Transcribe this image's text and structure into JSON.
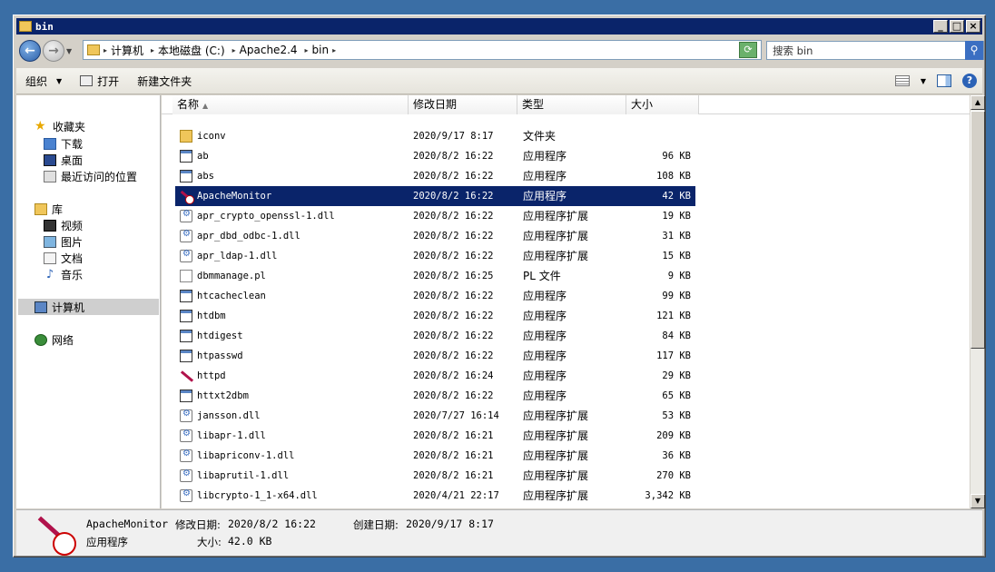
{
  "window": {
    "title": "bin"
  },
  "address": {
    "crumbs": [
      "计算机",
      "本地磁盘 (C:)",
      "Apache2.4",
      "bin"
    ],
    "search_placeholder": "搜索 bin"
  },
  "toolbar": {
    "organize": "组织",
    "open": "打开",
    "new_folder": "新建文件夹"
  },
  "nav": {
    "favorites": "收藏夹",
    "favorites_items": [
      "下载",
      "桌面",
      "最近访问的位置"
    ],
    "libraries": "库",
    "libraries_items": [
      "视频",
      "图片",
      "文档",
      "音乐"
    ],
    "computer": "计算机",
    "network": "网络"
  },
  "columns": {
    "name": "名称",
    "date": "修改日期",
    "type": "类型",
    "size": "大小"
  },
  "files": [
    {
      "name": "iconv",
      "date": "2020/9/17 8:17",
      "type": "文件夹",
      "size": "",
      "icon": "folder-icon"
    },
    {
      "name": "ab",
      "date": "2020/8/2 16:22",
      "type": "应用程序",
      "size": "96 KB",
      "icon": "exe-icon"
    },
    {
      "name": "abs",
      "date": "2020/8/2 16:22",
      "type": "应用程序",
      "size": "108 KB",
      "icon": "exe-icon"
    },
    {
      "name": "ApacheMonitor",
      "date": "2020/8/2 16:22",
      "type": "应用程序",
      "size": "42 KB",
      "icon": "apache-monitor-icon",
      "selected": true
    },
    {
      "name": "apr_crypto_openssl-1.dll",
      "date": "2020/8/2 16:22",
      "type": "应用程序扩展",
      "size": "19 KB",
      "icon": "dll-icon"
    },
    {
      "name": "apr_dbd_odbc-1.dll",
      "date": "2020/8/2 16:22",
      "type": "应用程序扩展",
      "size": "31 KB",
      "icon": "dll-icon"
    },
    {
      "name": "apr_ldap-1.dll",
      "date": "2020/8/2 16:22",
      "type": "应用程序扩展",
      "size": "15 KB",
      "icon": "dll-icon"
    },
    {
      "name": "dbmmanage.pl",
      "date": "2020/8/2 16:25",
      "type": "PL 文件",
      "size": "9 KB",
      "icon": "document-icon"
    },
    {
      "name": "htcacheclean",
      "date": "2020/8/2 16:22",
      "type": "应用程序",
      "size": "99 KB",
      "icon": "exe-icon"
    },
    {
      "name": "htdbm",
      "date": "2020/8/2 16:22",
      "type": "应用程序",
      "size": "121 KB",
      "icon": "exe-icon"
    },
    {
      "name": "htdigest",
      "date": "2020/8/2 16:22",
      "type": "应用程序",
      "size": "84 KB",
      "icon": "exe-icon"
    },
    {
      "name": "htpasswd",
      "date": "2020/8/2 16:22",
      "type": "应用程序",
      "size": "117 KB",
      "icon": "exe-icon"
    },
    {
      "name": "httpd",
      "date": "2020/8/2 16:24",
      "type": "应用程序",
      "size": "29 KB",
      "icon": "apache-feather-icon"
    },
    {
      "name": "httxt2dbm",
      "date": "2020/8/2 16:22",
      "type": "应用程序",
      "size": "65 KB",
      "icon": "exe-icon"
    },
    {
      "name": "jansson.dll",
      "date": "2020/7/27 16:14",
      "type": "应用程序扩展",
      "size": "53 KB",
      "icon": "dll-icon"
    },
    {
      "name": "libapr-1.dll",
      "date": "2020/8/2 16:21",
      "type": "应用程序扩展",
      "size": "209 KB",
      "icon": "dll-icon"
    },
    {
      "name": "libapriconv-1.dll",
      "date": "2020/8/2 16:21",
      "type": "应用程序扩展",
      "size": "36 KB",
      "icon": "dll-icon"
    },
    {
      "name": "libaprutil-1.dll",
      "date": "2020/8/2 16:21",
      "type": "应用程序扩展",
      "size": "270 KB",
      "icon": "dll-icon"
    },
    {
      "name": "libcrypto-1_1-x64.dll",
      "date": "2020/4/21 22:17",
      "type": "应用程序扩展",
      "size": "3,342 KB",
      "icon": "dll-icon"
    }
  ],
  "details": {
    "name": "ApacheMonitor",
    "modified_label": "修改日期:",
    "modified": "2020/8/2 16:22",
    "created_label": "创建日期:",
    "created": "2020/9/17 8:17",
    "type": "应用程序",
    "size_label": "大小:",
    "size": "42.0 KB"
  }
}
